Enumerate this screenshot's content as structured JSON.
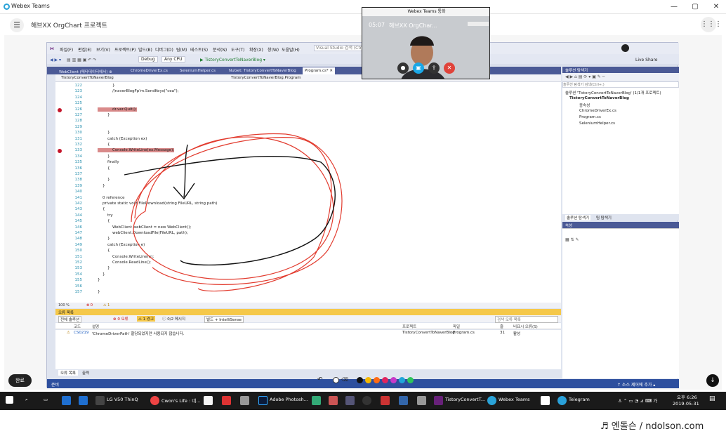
{
  "window": {
    "title": "Webex Teams",
    "minimize": "—",
    "maximize": "▢",
    "close": "✕"
  },
  "app": {
    "title": "해브XX OrgChart 프로젝트",
    "menu_icon": "☰",
    "grid_icon": "⋮⋮⋮"
  },
  "vs": {
    "menu": [
      "파일(F)",
      "편집(E)",
      "보기(V)",
      "프로젝트(P)",
      "빌드(B)",
      "디버그(D)",
      "팀(M)",
      "테스트(S)",
      "분석(N)",
      "도구(T)",
      "확장(X)",
      "창(W)",
      "도움말(H)"
    ],
    "search_placeholder": "Visual Studio 검색 (Ctrl+Q)",
    "toolbar": {
      "config": "Debug",
      "platform": "Any CPU",
      "run": "▶ TistoryConvertToNaverBlog ▾",
      "live_share": "Live Share"
    },
    "tabs": [
      "WebClient (메타데이터에서) ⊕",
      "ChromeDriverEx.cs",
      "SeleniumHelper.cs",
      "NuGet: TistoryConvertToNaverBlog",
      "Program.cs* ✕"
    ],
    "nav_left": "TistoryConvertToNaverBlog",
    "nav_right": "TistoryConvertToNaverBlog.Program",
    "code_lines": [
      {
        "n": "122",
        "t": "            }",
        "bp": false,
        "hl": false
      },
      {
        "n": "123",
        "t": "            //naverBlogFp'm.SendKeys(\"cea\");",
        "bp": false,
        "hl": false
      },
      {
        "n": "124",
        "t": "",
        "bp": false,
        "hl": false
      },
      {
        "n": "125",
        "t": "",
        "bp": false,
        "hl": false
      },
      {
        "n": "126",
        "t": "            dr.ver.Quit();",
        "bp": true,
        "hl": true
      },
      {
        "n": "127",
        "t": "        }",
        "bp": false,
        "hl": false
      },
      {
        "n": "128",
        "t": "",
        "bp": false,
        "hl": false
      },
      {
        "n": "129",
        "t": "",
        "bp": false,
        "hl": false
      },
      {
        "n": "130",
        "t": "        }",
        "bp": false,
        "hl": false
      },
      {
        "n": "131",
        "t": "        catch (Exception ex)",
        "bp": false,
        "hl": false
      },
      {
        "n": "132",
        "t": "        {",
        "bp": false,
        "hl": false
      },
      {
        "n": "133",
        "t": "            Console.WriteLine(ex.Message);",
        "bp": true,
        "hl": true
      },
      {
        "n": "134",
        "t": "        }",
        "bp": false,
        "hl": false
      },
      {
        "n": "135",
        "t": "        finally",
        "bp": false,
        "hl": false
      },
      {
        "n": "136",
        "t": "        {",
        "bp": false,
        "hl": false
      },
      {
        "n": "137",
        "t": "",
        "bp": false,
        "hl": false
      },
      {
        "n": "138",
        "t": "        }",
        "bp": false,
        "hl": false
      },
      {
        "n": "139",
        "t": "    }",
        "bp": false,
        "hl": false
      },
      {
        "n": "140",
        "t": "",
        "bp": false,
        "hl": false
      },
      {
        "n": "141",
        "t": "    0 reference",
        "bp": false,
        "hl": false
      },
      {
        "n": "142",
        "t": "    private static void FileDownload(string FileURL, string path)",
        "bp": false,
        "hl": false
      },
      {
        "n": "143",
        "t": "    {",
        "bp": false,
        "hl": false
      },
      {
        "n": "144",
        "t": "        try",
        "bp": false,
        "hl": false
      },
      {
        "n": "145",
        "t": "        {",
        "bp": false,
        "hl": false
      },
      {
        "n": "146",
        "t": "            WebClient webClient = new WebClient();",
        "bp": false,
        "hl": false
      },
      {
        "n": "147",
        "t": "            webClient.DownloadFile(FileURL, path);",
        "bp": false,
        "hl": false
      },
      {
        "n": "148",
        "t": "        }",
        "bp": false,
        "hl": false
      },
      {
        "n": "149",
        "t": "        catch (Exception e)",
        "bp": false,
        "hl": false
      },
      {
        "n": "150",
        "t": "        {",
        "bp": false,
        "hl": false
      },
      {
        "n": "151",
        "t": "            Console.WriteLine(e);",
        "bp": false,
        "hl": false
      },
      {
        "n": "152",
        "t": "            Console.ReadLine();",
        "bp": false,
        "hl": false
      },
      {
        "n": "153",
        "t": "        }",
        "bp": false,
        "hl": false
      },
      {
        "n": "154",
        "t": "    }",
        "bp": false,
        "hl": false
      },
      {
        "n": "155",
        "t": "}",
        "bp": false,
        "hl": false
      },
      {
        "n": "156",
        "t": "",
        "bp": false,
        "hl": false
      },
      {
        "n": "157",
        "t": "}",
        "bp": false,
        "hl": false
      }
    ],
    "editor_status": {
      "zoom": "100 %",
      "errors": "⊗ 0",
      "warnings": "⚠ 1"
    },
    "error_list": {
      "title": "오류 목록",
      "scope": "전체 솔루션",
      "errors": "⊗ 0 오류",
      "warnings": "⚠ 1 경고",
      "messages": "ⓘ 0/2 메시지",
      "build": "빌드 + IntelliSense",
      "search": "검색 오류 목록",
      "columns": [
        "코드",
        "설명",
        "프로젝트",
        "파일",
        "줄",
        "비표시 오류(S)"
      ],
      "row": {
        "code": "CS0219",
        "desc": "'ChromeDriverPath' 할당되었지만 사용되지 않습니다.",
        "project": "TistoryConvertToNaverBlog",
        "file": "Program.cs",
        "line": "31",
        "state": "활성"
      }
    },
    "bottom_tabs": [
      "오류 목록",
      "출력"
    ],
    "status": {
      "left": "준비",
      "right": "↑ 소스 제어에 추가 ▴"
    },
    "solution": {
      "title": "솔루션 탐색기",
      "search": "솔루션 탐색기 검색(Ctrl+;)",
      "nodes": [
        "솔루션 'TistoryConvertToNaverBlog' (1/1개 프로젝트)",
        "TistoryConvertToNaverBlog",
        "종속성",
        "ChromeDriverEx.cs",
        "Program.cs",
        "SeleniumHelper.cs"
      ],
      "tabs": [
        "솔루션 탐색기",
        "팀 탐색기"
      ]
    },
    "properties": {
      "title": "속성"
    }
  },
  "call": {
    "title": "Webex Teams 통화",
    "time": "05:07",
    "name": "해브XX OrgChar..."
  },
  "done_button": "완료",
  "down_icon": "↓",
  "annot_colors": [
    "#111111",
    "#f5b800",
    "#ff6a13",
    "#e0245e",
    "#c73ac9",
    "#20a6d9",
    "#2ec45b"
  ],
  "taskbar": {
    "items": [
      "LG V50 ThinQ",
      "Cwon's Life : 네...",
      "Adobe Photosh...",
      "TistoryConvertT...",
      "Webex Teams",
      "Telegram"
    ],
    "time": "오후 6:26",
    "date": "2019-05-31"
  },
  "watermark": "♬ 엔돌슨 / ndolson.com"
}
